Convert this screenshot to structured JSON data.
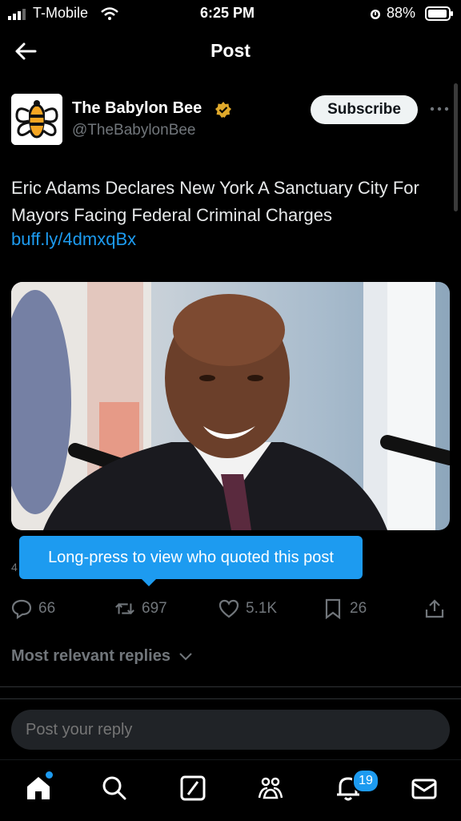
{
  "status_bar": {
    "carrier": "T-Mobile",
    "time": "6:25 PM",
    "battery": "88%"
  },
  "header": {
    "title": "Post"
  },
  "post": {
    "author_name": "The Babylon Bee",
    "handle": "@TheBabylonBee",
    "subscribe_label": "Subscribe",
    "text": "Eric Adams Declares New York A Sanctuary City For Mayors Facing Federal Criminal Charges",
    "link": "buff.ly/4dmxqBx",
    "partial_text": "4"
  },
  "tooltip": {
    "text": "Long-press to view who quoted this post"
  },
  "actions": {
    "replies": "66",
    "reposts": "697",
    "likes": "5.1K",
    "bookmarks": "26"
  },
  "replies": {
    "sort_label": "Most relevant replies",
    "input_placeholder": "Post your reply"
  },
  "tabbar": {
    "notifications_count": "19"
  },
  "colors": {
    "accent": "#1d9bf0",
    "background": "#000000",
    "muted": "#71767b",
    "badge_gold": "#e0a92b"
  }
}
